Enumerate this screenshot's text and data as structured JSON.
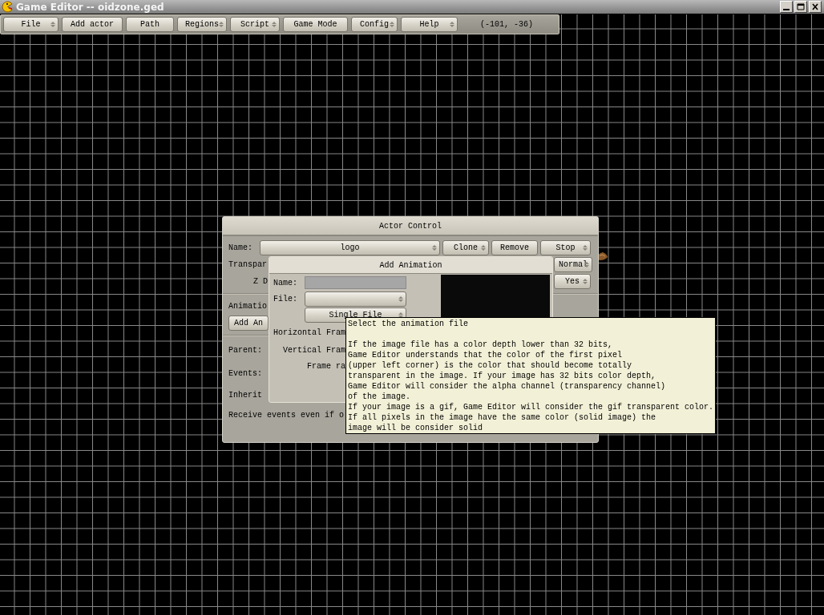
{
  "window": {
    "title": "Game Editor -- oidzone.ged"
  },
  "menu": [
    {
      "label": "File",
      "kind": "dropdown"
    },
    {
      "label": "Add actor",
      "kind": "button"
    },
    {
      "label": "Path",
      "kind": "button"
    },
    {
      "label": "Regions",
      "kind": "dropdown"
    },
    {
      "label": "Script",
      "kind": "dropdown"
    },
    {
      "label": "Game Mode",
      "kind": "button"
    },
    {
      "label": "Config",
      "kind": "dropdown"
    },
    {
      "label": "Help",
      "kind": "dropdown"
    }
  ],
  "coordinates": "(-101, -36)",
  "actor_control": {
    "title": "Actor Control",
    "name_label": "Name:",
    "name_value": "logo",
    "buttons": [
      {
        "label": "Clone",
        "kind": "dropdown"
      },
      {
        "label": "Remove",
        "kind": "button"
      },
      {
        "label": "Stop",
        "kind": "dropdown"
      }
    ],
    "transparency_label": "Transpar",
    "mode": "Normal",
    "z_depth_label": "Z D",
    "create_at_startup": "Yes",
    "animation_label": "Animatio",
    "add_animation": "Add An",
    "parent_label": "Parent:",
    "events_label": "Events:",
    "inherit_label": "Inherit",
    "receive_label": "Receive events even if o"
  },
  "add_animation": {
    "title": "Add Animation",
    "name_label": "Name:",
    "file_label": "File:",
    "file_type": "Single File",
    "horizontal_label": "Horizontal Fram",
    "vertical_label": "Vertical Fram",
    "frame_rate_label": "Frame ra"
  },
  "tooltip": {
    "title": "Select the animation file",
    "lines": [
      "If the image file has a color depth lower than 32 bits,",
      "Game Editor understands that the color of the first pixel",
      "(upper left corner) is the color that should become totally",
      "transparent in the image. If your image has 32 bits color depth,",
      "Game Editor will consider the alpha channel (transparency channel)",
      "of the image.",
      "If your image is a gif, Game Editor will consider the gif transparent color.",
      "If all pixels in the image have the same color (solid image) the",
      "image will be consider solid"
    ]
  }
}
